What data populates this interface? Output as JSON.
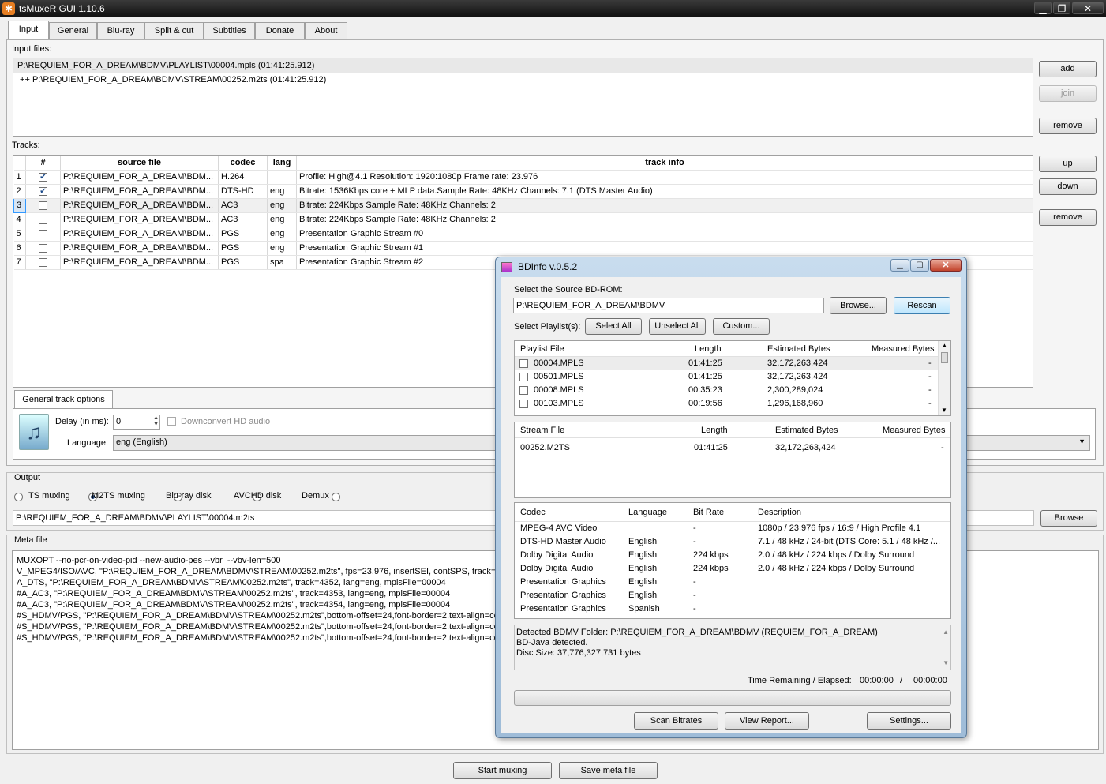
{
  "window": {
    "title": "tsMuxeR GUI 1.10.6",
    "min": "▁",
    "max": "❐",
    "close": "✕"
  },
  "tabs": [
    "Input",
    "General",
    "Blu-ray",
    "Split & cut",
    "Subtitles",
    "Donate",
    "About"
  ],
  "input": {
    "label": "Input files:",
    "files": [
      "P:\\REQUIEM_FOR_A_DREAM\\BDMV\\PLAYLIST\\00004.mpls (01:41:25.912)",
      " ++ P:\\REQUIEM_FOR_A_DREAM\\BDMV\\STREAM\\00252.m2ts (01:41:25.912)"
    ],
    "add": "add",
    "join": "join",
    "remove": "remove"
  },
  "tracks": {
    "label": "Tracks:",
    "headers": [
      "#",
      "source file",
      "codec",
      "lang",
      "track info"
    ],
    "rows": [
      {
        "n": "1",
        "checked": true,
        "file": "P:\\REQUIEM_FOR_A_DREAM\\BDM...",
        "codec": "H.264",
        "lang": "",
        "info": "Profile: High@4.1  Resolution: 1920:1080p  Frame rate: 23.976"
      },
      {
        "n": "2",
        "checked": true,
        "file": "P:\\REQUIEM_FOR_A_DREAM\\BDM...",
        "codec": "DTS-HD",
        "lang": "eng",
        "info": "Bitrate: 1536Kbps  core + MLP data.Sample Rate: 48KHz  Channels: 7.1 (DTS Master Audio)"
      },
      {
        "n": "3",
        "checked": false,
        "file": "P:\\REQUIEM_FOR_A_DREAM\\BDM...",
        "codec": "AC3",
        "lang": "eng",
        "info": "Bitrate: 224Kbps Sample Rate: 48KHz Channels: 2"
      },
      {
        "n": "4",
        "checked": false,
        "file": "P:\\REQUIEM_FOR_A_DREAM\\BDM...",
        "codec": "AC3",
        "lang": "eng",
        "info": "Bitrate: 224Kbps Sample Rate: 48KHz Channels: 2"
      },
      {
        "n": "5",
        "checked": false,
        "file": "P:\\REQUIEM_FOR_A_DREAM\\BDM...",
        "codec": "PGS",
        "lang": "eng",
        "info": "Presentation Graphic Stream #0"
      },
      {
        "n": "6",
        "checked": false,
        "file": "P:\\REQUIEM_FOR_A_DREAM\\BDM...",
        "codec": "PGS",
        "lang": "eng",
        "info": "Presentation Graphic Stream #1"
      },
      {
        "n": "7",
        "checked": false,
        "file": "P:\\REQUIEM_FOR_A_DREAM\\BDM...",
        "codec": "PGS",
        "lang": "spa",
        "info": "Presentation Graphic Stream #2"
      }
    ],
    "up": "up",
    "down": "down",
    "remove": "remove"
  },
  "track_options": {
    "tab": "General track options",
    "delay_label": "Delay (in ms):",
    "delay_value": "0",
    "downconvert": "Downconvert HD audio",
    "language_label": "Language:",
    "language_value": "eng (English)"
  },
  "output": {
    "label": "Output",
    "options": [
      "TS muxing",
      "M2TS muxing",
      "Blu-ray disk",
      "AVCHD disk",
      "Demux"
    ],
    "selected": "M2TS muxing",
    "path": "P:\\REQUIEM_FOR_A_DREAM\\BDMV\\PLAYLIST\\00004.m2ts",
    "browse": "Browse"
  },
  "meta": {
    "label": "Meta file",
    "lines": [
      "MUXOPT --no-pcr-on-video-pid --new-audio-pes --vbr  --vbv-len=500",
      "V_MPEG4/ISO/AVC, \"P:\\REQUIEM_FOR_A_DREAM\\BDMV\\STREAM\\00252.m2ts\", fps=23.976, insertSEI, contSPS, track=4113",
      "A_DTS, \"P:\\REQUIEM_FOR_A_DREAM\\BDMV\\STREAM\\00252.m2ts\", track=4352, lang=eng, mplsFile=00004",
      "#A_AC3, \"P:\\REQUIEM_FOR_A_DREAM\\BDMV\\STREAM\\00252.m2ts\", track=4353, lang=eng, mplsFile=00004",
      "#A_AC3, \"P:\\REQUIEM_FOR_A_DREAM\\BDMV\\STREAM\\00252.m2ts\", track=4354, lang=eng, mplsFile=00004",
      "#S_HDMV/PGS, \"P:\\REQUIEM_FOR_A_DREAM\\BDMV\\STREAM\\00252.m2ts\",bottom-offset=24,font-border=2,text-align=cent",
      "#S_HDMV/PGS, \"P:\\REQUIEM_FOR_A_DREAM\\BDMV\\STREAM\\00252.m2ts\",bottom-offset=24,font-border=2,text-align=cent",
      "#S_HDMV/PGS, \"P:\\REQUIEM_FOR_A_DREAM\\BDMV\\STREAM\\00252.m2ts\",bottom-offset=24,font-border=2,text-align=cent"
    ]
  },
  "footer": {
    "start": "Start muxing",
    "save": "Save meta file"
  },
  "bdinfo": {
    "title": "BDInfo v.0.5.2",
    "source_label": "Select the Source BD-ROM:",
    "source_value": "P:\\REQUIEM_FOR_A_DREAM\\BDMV",
    "browse": "Browse...",
    "rescan": "Rescan",
    "playlists_label": "Select Playlist(s):",
    "select_all": "Select All",
    "unselect_all": "Unselect All",
    "custom": "Custom...",
    "playlist_headers": [
      "Playlist File",
      "Length",
      "Estimated Bytes",
      "Measured Bytes"
    ],
    "playlists": [
      {
        "file": "00004.MPLS",
        "length": "01:41:25",
        "est": "32,172,263,424",
        "meas": "-"
      },
      {
        "file": "00501.MPLS",
        "length": "01:41:25",
        "est": "32,172,263,424",
        "meas": "-"
      },
      {
        "file": "00008.MPLS",
        "length": "00:35:23",
        "est": "2,300,289,024",
        "meas": "-"
      },
      {
        "file": "00103.MPLS",
        "length": "00:19:56",
        "est": "1,296,168,960",
        "meas": "-"
      }
    ],
    "stream_headers": [
      "Stream File",
      "Length",
      "Estimated Bytes",
      "Measured Bytes"
    ],
    "streams": [
      {
        "file": "00252.M2TS",
        "length": "01:41:25",
        "est": "32,172,263,424",
        "meas": "-"
      }
    ],
    "codec_headers": [
      "Codec",
      "Language",
      "Bit Rate",
      "Description"
    ],
    "codecs": [
      {
        "codec": "MPEG-4 AVC Video",
        "lang": "",
        "rate": "-",
        "desc": "1080p / 23.976 fps / 16:9 / High Profile 4.1"
      },
      {
        "codec": "DTS-HD Master Audio",
        "lang": "English",
        "rate": "-",
        "desc": "7.1 / 48 kHz / 24-bit (DTS Core: 5.1 / 48 kHz /..."
      },
      {
        "codec": "Dolby Digital Audio",
        "lang": "English",
        "rate": "224 kbps",
        "desc": "2.0 / 48 kHz / 224 kbps / Dolby Surround"
      },
      {
        "codec": "Dolby Digital Audio",
        "lang": "English",
        "rate": "224 kbps",
        "desc": "2.0 / 48 kHz / 224 kbps / Dolby Surround"
      },
      {
        "codec": "Presentation Graphics",
        "lang": "English",
        "rate": "-",
        "desc": ""
      },
      {
        "codec": "Presentation Graphics",
        "lang": "English",
        "rate": "-",
        "desc": ""
      },
      {
        "codec": "Presentation Graphics",
        "lang": "Spanish",
        "rate": "-",
        "desc": ""
      }
    ],
    "log": [
      "Detected BDMV Folder: P:\\REQUIEM_FOR_A_DREAM\\BDMV (REQUIEM_FOR_A_DREAM)",
      "BD-Java detected.",
      "Disc Size: 37,776,327,731 bytes"
    ],
    "time_label": "Time Remaining / Elapsed:",
    "time_remaining": "00:00:00",
    "time_sep": "/",
    "time_elapsed": "00:00:00",
    "scan": "Scan Bitrates",
    "report": "View Report...",
    "settings": "Settings..."
  }
}
